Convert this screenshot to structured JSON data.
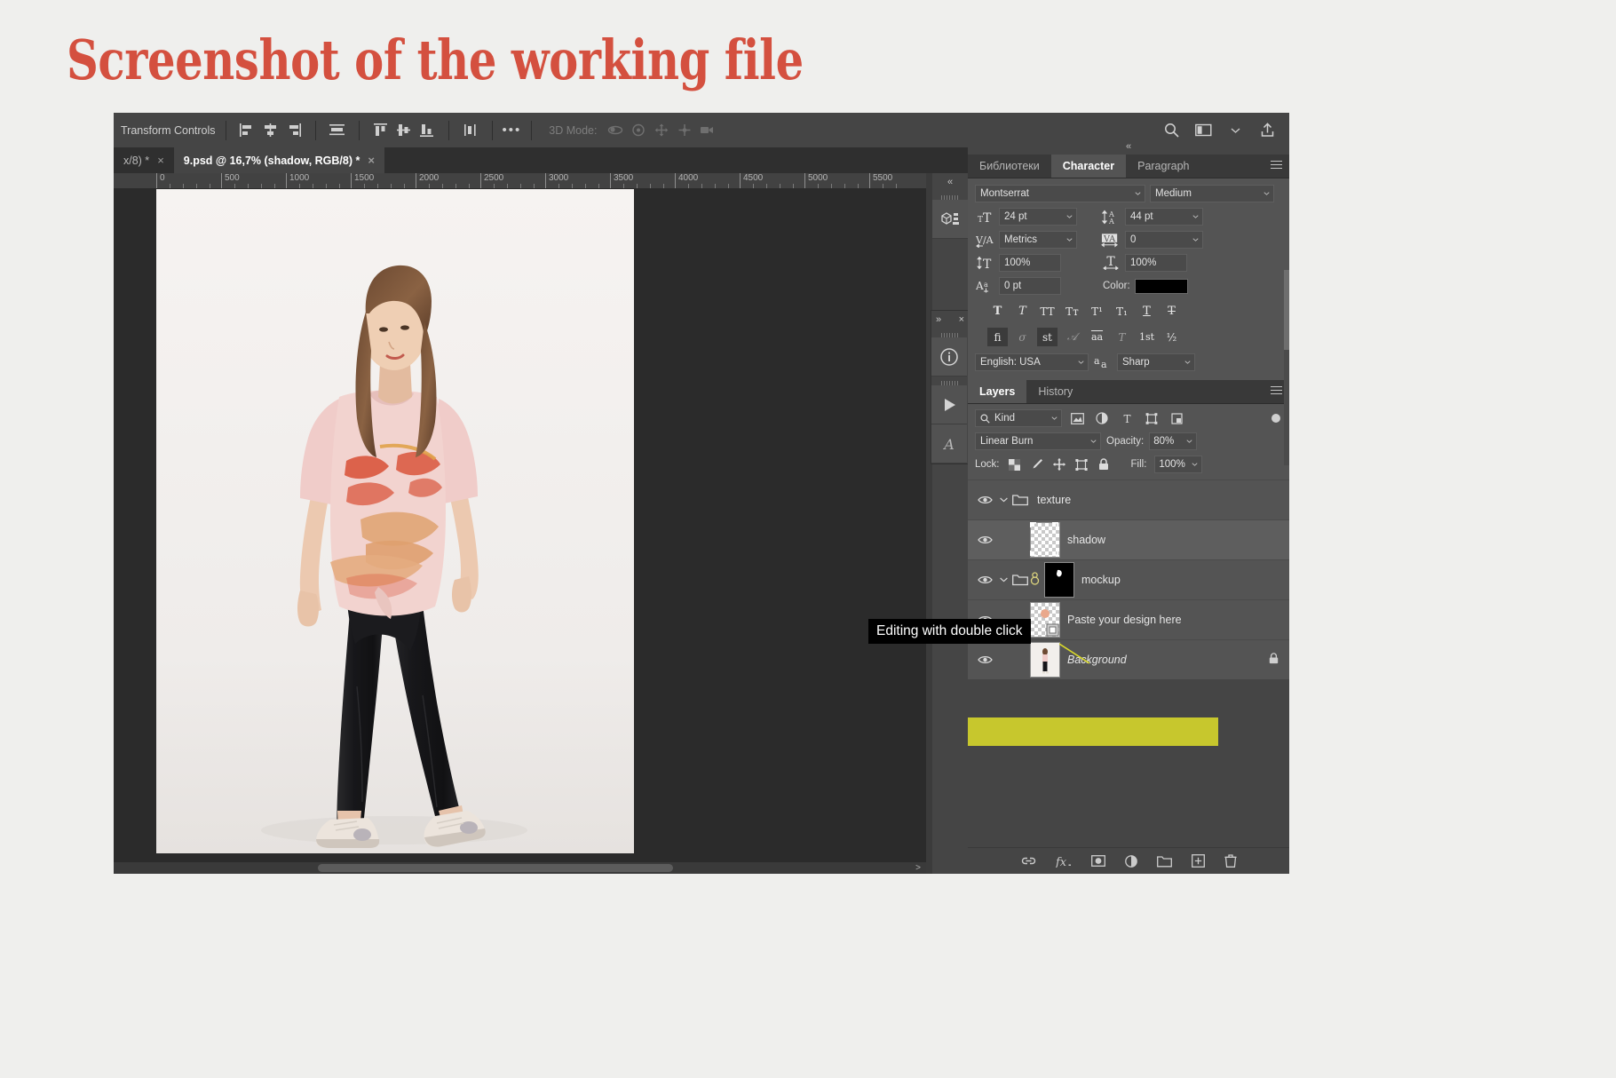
{
  "page": {
    "title": "Screenshot of the working file",
    "title_color": "#d4503f",
    "background_color": "#efefed"
  },
  "options_bar": {
    "transform_controls_label": "Transform Controls",
    "align_icons": [
      "align-left-edges-icon",
      "align-horizontal-centers-icon",
      "align-right-edges-icon",
      "distribute-horizontal-icon",
      "align-top-edges-icon",
      "align-vertical-centers-icon",
      "align-bottom-edges-icon",
      "distribute-vertical-icon"
    ],
    "more_label": "•••",
    "mode_3d_label": "3D Mode:",
    "mode_3d_icons": [
      "orbit-3d-icon",
      "roll-3d-icon",
      "pan-3d-icon",
      "slide-3d-icon",
      "zoom-3d-camera-icon"
    ],
    "right_icons": [
      "search-icon",
      "workspace-arrange-icon",
      "chevron-down-icon",
      "share-icon"
    ]
  },
  "tabs": {
    "items": [
      {
        "label": "x/8) *",
        "active": false,
        "close": "×"
      },
      {
        "label": "9.psd @ 16,7% (shadow, RGB/8) *",
        "active": true,
        "close": "×"
      }
    ]
  },
  "ruler": {
    "ticks": [
      "0",
      "500",
      "1000",
      "1500",
      "2000",
      "2500",
      "3000",
      "3500",
      "4000",
      "4500",
      "5000",
      "5500"
    ]
  },
  "mini_dock": {
    "collapse_label": "«",
    "buttons": [
      "3d-properties-icon",
      "info-icon",
      "play-icon",
      "glyphs-icon"
    ],
    "float_panel": {
      "expand_label": "»",
      "close_label": "×"
    }
  },
  "panels": {
    "top": {
      "tabs": [
        {
          "label": "Библиотеки",
          "active": false
        },
        {
          "label": "Character",
          "active": true
        },
        {
          "label": "Paragraph",
          "active": false
        }
      ],
      "character": {
        "font_family": "Montserrat",
        "font_style": "Medium",
        "size_icon": "font-size-icon",
        "size": "24 pt",
        "leading_icon": "leading-icon",
        "leading": "44 pt",
        "kerning_icon": "kerning-icon",
        "kerning": "Metrics",
        "tracking_icon": "tracking-icon",
        "tracking": "0",
        "vertical_scale_icon": "vertical-scale-icon",
        "vertical_scale": "100%",
        "horizontal_scale_icon": "horizontal-scale-icon",
        "horizontal_scale": "100%",
        "baseline_icon": "baseline-shift-icon",
        "baseline_shift": "0 pt",
        "color_label": "Color:",
        "color_value": "#000000",
        "style_buttons": [
          {
            "name": "faux-bold-icon",
            "glyph": "T",
            "on": false
          },
          {
            "name": "faux-italic-icon",
            "glyph": "T",
            "on": false
          },
          {
            "name": "all-caps-icon",
            "glyph": "TT",
            "on": false
          },
          {
            "name": "small-caps-icon",
            "glyph": "Tᴛ",
            "on": false
          },
          {
            "name": "superscript-icon",
            "glyph": "T¹",
            "on": false
          },
          {
            "name": "subscript-icon",
            "glyph": "T₁",
            "on": false
          },
          {
            "name": "underline-icon",
            "glyph": "T",
            "on": false
          },
          {
            "name": "strikethrough-icon",
            "glyph": "T",
            "on": false
          }
        ],
        "opentype_buttons": [
          {
            "name": "standard-ligatures-icon",
            "glyph": "fi",
            "on": true
          },
          {
            "name": "contextual-alternates-icon",
            "glyph": "σ",
            "on": false
          },
          {
            "name": "discretionary-ligatures-icon",
            "glyph": "st",
            "on": true
          },
          {
            "name": "swash-icon",
            "glyph": "𝒜",
            "on": false
          },
          {
            "name": "oldstyle-icon",
            "glyph": "aa",
            "on": false
          },
          {
            "name": "titling-alternates-icon",
            "glyph": "T",
            "on": false
          },
          {
            "name": "ordinals-icon",
            "glyph": "1st",
            "on": false
          },
          {
            "name": "fractions-icon",
            "glyph": "½",
            "on": false
          }
        ],
        "language": "English: USA",
        "aa_icon": "anti-alias-icon",
        "antialias": "Sharp"
      }
    },
    "layers": {
      "tabs": [
        {
          "label": "Layers",
          "active": true
        },
        {
          "label": "History",
          "active": false
        }
      ],
      "filter_label": "Kind",
      "filter_icons": [
        "pixel-filter-icon",
        "adjustment-filter-icon",
        "type-filter-icon",
        "shape-filter-icon",
        "smart-object-filter-icon"
      ],
      "blend_mode": "Linear Burn",
      "opacity_label": "Opacity:",
      "opacity_value": "80%",
      "lock_label": "Lock:",
      "lock_icons": [
        "lock-transparent-pixels-icon",
        "lock-image-pixels-icon",
        "lock-position-icon",
        "lock-artboard-icon",
        "lock-all-icon"
      ],
      "fill_label": "Fill:",
      "fill_value": "100%",
      "rows": [
        {
          "name": "texture",
          "type": "group",
          "visible": true,
          "selected": false,
          "expanded": true,
          "locked": false,
          "italic": false,
          "linked": false,
          "thumb": "none"
        },
        {
          "name": "shadow",
          "type": "pixel",
          "visible": true,
          "selected": true,
          "expanded": false,
          "locked": false,
          "italic": false,
          "linked": false,
          "thumb": "transparent"
        },
        {
          "name": "mockup",
          "type": "group",
          "visible": true,
          "selected": false,
          "expanded": true,
          "locked": false,
          "italic": false,
          "linked": true,
          "thumb": "mask"
        },
        {
          "name": "Paste your design here",
          "type": "smart-object",
          "visible": true,
          "selected": false,
          "expanded": false,
          "locked": false,
          "italic": false,
          "linked": false,
          "thumb": "design"
        },
        {
          "name": "Background",
          "type": "image",
          "visible": true,
          "selected": false,
          "expanded": false,
          "locked": true,
          "italic": true,
          "linked": false,
          "thumb": "photo"
        }
      ],
      "footer_icons": [
        "link-layers-icon",
        "layer-style-icon",
        "layer-mask-icon",
        "adjustment-layer-icon",
        "new-group-icon",
        "new-layer-icon",
        "delete-layer-icon"
      ],
      "footer_fx_label": "fx"
    }
  },
  "annotation": {
    "tooltip_text": "Editing with double click",
    "highlight_color": "#d9d92a"
  }
}
